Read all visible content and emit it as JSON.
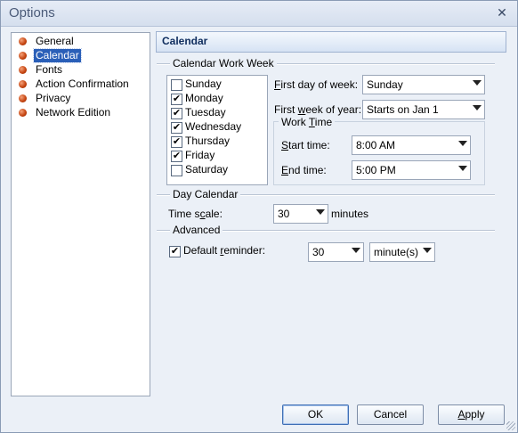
{
  "window": {
    "title": "Options",
    "close_glyph": "✕"
  },
  "sidebar": {
    "items": [
      {
        "label": "General"
      },
      {
        "label": "Calendar",
        "selected": true
      },
      {
        "label": "Fonts"
      },
      {
        "label": "Action Confirmation"
      },
      {
        "label": "Privacy"
      },
      {
        "label": "Network Edition"
      }
    ]
  },
  "panel": {
    "header": "Calendar",
    "work_week": {
      "title": "Calendar Work Week",
      "days": [
        {
          "label": "Sunday",
          "checked": false
        },
        {
          "label": "Monday",
          "checked": true
        },
        {
          "label": "Tuesday",
          "checked": true
        },
        {
          "label": "Wednesday",
          "checked": true
        },
        {
          "label": "Thursday",
          "checked": true
        },
        {
          "label": "Friday",
          "checked": true
        },
        {
          "label": "Saturday",
          "checked": false
        }
      ],
      "first_day": {
        "label_u": "F",
        "label_rest": "irst day of week:",
        "value": "Sunday"
      },
      "first_week": {
        "label_pre": "First ",
        "label_u": "w",
        "label_rest": "eek of year:",
        "value": "Starts on Jan 1"
      },
      "work_time": {
        "title_pre": "Work ",
        "title_u": "T",
        "title_rest": "ime",
        "start": {
          "label_u": "S",
          "label_rest": "tart time:",
          "value": "8:00 AM"
        },
        "end": {
          "label_u": "E",
          "label_rest": "nd time:",
          "value": "5:00 PM"
        }
      }
    },
    "day_calendar": {
      "title": "Day Calendar",
      "time_scale": {
        "label_pre": "Time s",
        "label_u": "c",
        "label_rest": "ale:",
        "value": "30",
        "unit": "minutes"
      }
    },
    "advanced": {
      "title": "Advanced",
      "default_reminder": {
        "label_pre": "Default ",
        "label_u": "r",
        "label_rest": "eminder:",
        "checked": true,
        "value": "30",
        "unit": "minute(s)"
      }
    }
  },
  "buttons": {
    "ok": "OK",
    "cancel": "Cancel",
    "apply_u": "A",
    "apply_rest": "pply"
  }
}
